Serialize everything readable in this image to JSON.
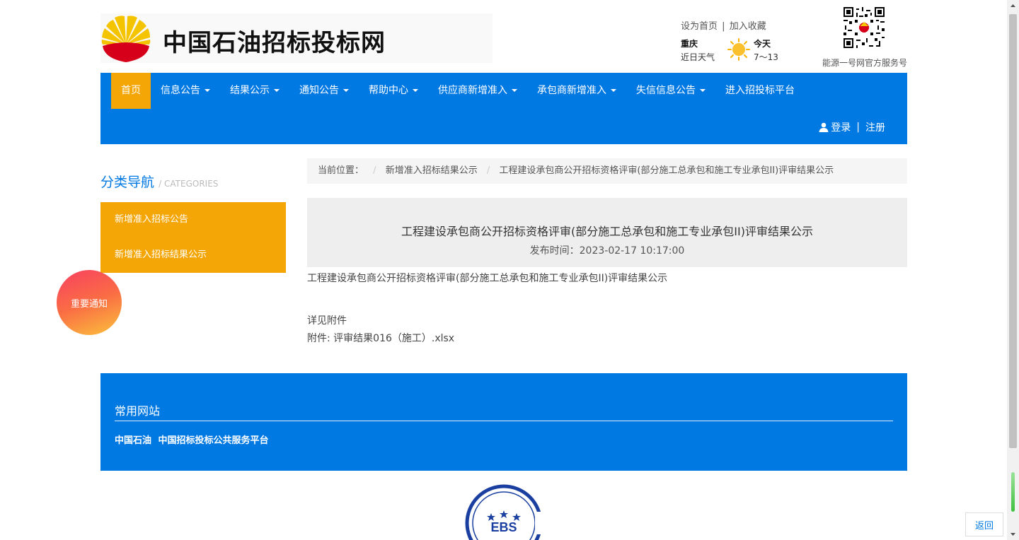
{
  "header": {
    "site_title": "中国石油招标投标网",
    "top_links": {
      "set_home": "设为首页",
      "separator": "|",
      "add_favorite": "加入收藏"
    },
    "weather": {
      "city": "重庆",
      "note": "近日天气",
      "day": "今天",
      "temp": "7～13",
      "icon": "sun-icon"
    },
    "qr_caption": "能源一号网官方服务号"
  },
  "nav": {
    "items": [
      {
        "label": "首页",
        "active": true
      },
      {
        "label": "信息公告",
        "dropdown": true
      },
      {
        "label": "结果公示",
        "dropdown": true
      },
      {
        "label": "通知公告",
        "dropdown": true
      },
      {
        "label": "帮助中心",
        "dropdown": true
      },
      {
        "label": "供应商新增准入",
        "dropdown": true
      },
      {
        "label": "承包商新增准入",
        "dropdown": true
      },
      {
        "label": "失信信息公告",
        "dropdown": true
      },
      {
        "label": "进入招投标平台"
      }
    ],
    "auth": {
      "login": "登录",
      "separator": "|",
      "register": "注册"
    }
  },
  "sidebar": {
    "title": "分类导航",
    "subtitle": "/ CATEGORIES",
    "items": [
      {
        "label": "新增准入招标公告"
      },
      {
        "label": "新增准入招标结果公示"
      }
    ]
  },
  "breadcrumb": {
    "label": "当前位置：",
    "items": [
      "新增准入招标结果公示",
      "工程建设承包商公开招标资格评审(部分施工总承包和施工专业承包II)评审结果公示"
    ]
  },
  "article": {
    "title": "工程建设承包商公开招标资格评审(部分施工总承包和施工专业承包II)评审结果公示",
    "publish_time": "发布时间：2023-02-17 10:17:00",
    "intro": "工程建设承包商公开招标资格评审(部分施工总承包和施工专业承包II)评审结果公示",
    "see_attachment": "详见附件",
    "attachment_label": "附件: ",
    "attachment_name": "评审结果016（施工）.xlsx"
  },
  "footer": {
    "title": "常用网站",
    "links": [
      "中国石油",
      "中国招标投标公共服务平台"
    ]
  },
  "floating": {
    "notice": "重要通知",
    "back": "返回"
  },
  "ebs_logo": {
    "text": "EBS"
  },
  "colors": {
    "primary_blue": "#0179e3",
    "accent_orange": "#f5a607"
  }
}
